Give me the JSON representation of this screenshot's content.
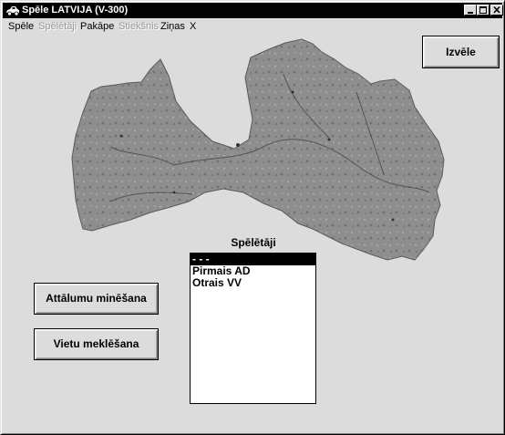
{
  "window": {
    "title": "Spēle LATVIJA (V-300)"
  },
  "menu": {
    "items": [
      {
        "label": "Spēle",
        "enabled": true
      },
      {
        "label": "Spēlētāji",
        "enabled": false
      },
      {
        "label": "Pakāpe",
        "enabled": true
      },
      {
        "label": "Stiekšnis",
        "enabled": false
      },
      {
        "label": "Ziņas",
        "enabled": true
      },
      {
        "label": "X",
        "enabled": true
      }
    ]
  },
  "buttons": {
    "choose": "Izvēle",
    "distance_guessing": "Attālumu minēšana",
    "place_search": "Vietu meklēšana"
  },
  "players": {
    "label": "Spēlētāji",
    "items": [
      {
        "name": "- - -",
        "selected": true
      },
      {
        "name": "Pirmais AD",
        "selected": false
      },
      {
        "name": "Otrais VV",
        "selected": false
      }
    ]
  },
  "map": {
    "region": "Latvija",
    "fill": "#8c8c8c",
    "river_color": "#4a4a4a"
  },
  "icons": {
    "app": "car-icon",
    "minimize": "minimize-icon",
    "maximize": "maximize-icon",
    "close": "close-icon"
  }
}
